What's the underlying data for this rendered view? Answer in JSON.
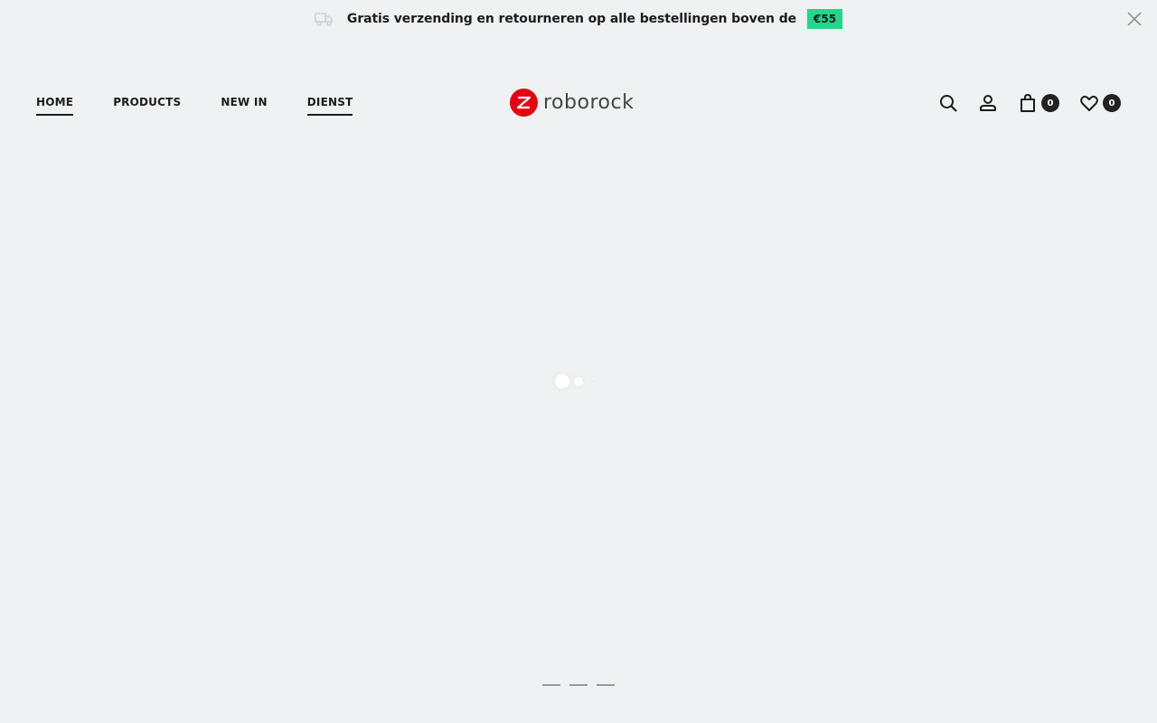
{
  "announcement": {
    "text": "Gratis verzending en retourneren op alle bestellingen boven de",
    "badge": "€55",
    "icon": "truck-icon",
    "close_icon": "close-icon"
  },
  "nav": {
    "items": [
      {
        "label": "HOME",
        "active": true
      },
      {
        "label": "PRODUCTS",
        "active": false
      },
      {
        "label": "NEW IN",
        "active": false
      },
      {
        "label": "DIENST",
        "active": true
      }
    ]
  },
  "brand": {
    "name": "roborock",
    "color": "#e60012"
  },
  "actions": {
    "search_icon": "search-icon",
    "account_icon": "user-icon",
    "cart_icon": "shopping-bag-icon",
    "cart_count": "0",
    "wishlist_icon": "heart-icon",
    "wishlist_count": "0"
  },
  "slider": {
    "pages": 3
  },
  "colors": {
    "background": "#f0f1f3",
    "badge": "#22d68a",
    "text": "#1c1c1c"
  }
}
